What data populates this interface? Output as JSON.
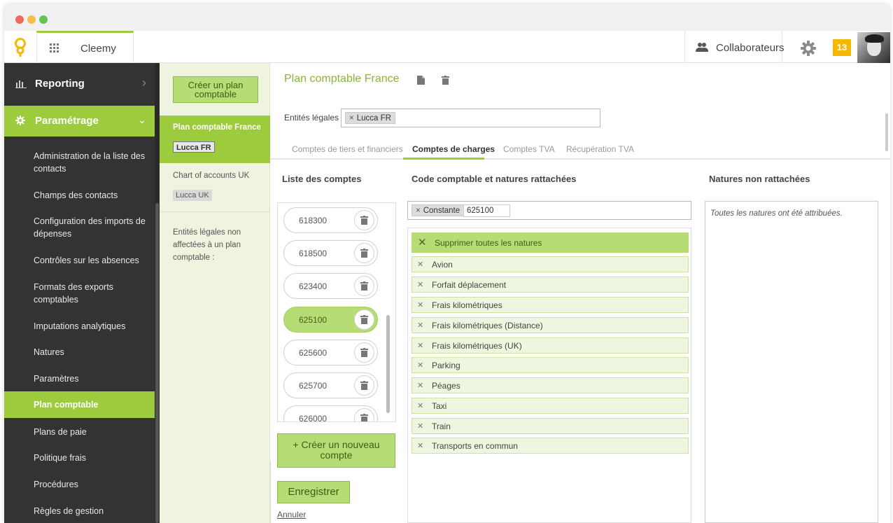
{
  "app": {
    "name": "Cleemy"
  },
  "header": {
    "collaborators_label": "Collaborateurs",
    "notifications_count": "13",
    "accent_color": "#9ccb3d",
    "badge_color": "#f5b800"
  },
  "sidebar": {
    "reporting": "Reporting",
    "parametrage": "Paramétrage",
    "items": [
      {
        "label": "Administration de la liste des contacts"
      },
      {
        "label": "Champs des contacts"
      },
      {
        "label": "Configuration des imports de dépenses"
      },
      {
        "label": "Contrôles sur les absences"
      },
      {
        "label": "Formats des exports comptables"
      },
      {
        "label": "Imputations analytiques"
      },
      {
        "label": "Natures"
      },
      {
        "label": "Paramètres"
      },
      {
        "label": "Plan comptable"
      },
      {
        "label": "Plans de paie"
      },
      {
        "label": "Politique frais"
      },
      {
        "label": "Procédures"
      },
      {
        "label": "Règles de gestion"
      }
    ],
    "active_item": "Plan comptable"
  },
  "plans": {
    "create_button": "Créer un plan comptable",
    "items": [
      {
        "title": "Plan comptable France",
        "tag": "Lucca FR"
      },
      {
        "title": "Chart of accounts UK",
        "tag": "Lucca UK"
      }
    ],
    "unassigned_text": "Entités légales non affectées à un plan comptable :"
  },
  "main": {
    "title": "Plan comptable France",
    "entities_label": "Entités légales :",
    "entities": [
      "Lucca FR"
    ],
    "tabs": [
      {
        "label": "Comptes de tiers et financiers"
      },
      {
        "label": "Comptes de charges"
      },
      {
        "label": "Comptes TVA"
      },
      {
        "label": "Récupération TVA"
      }
    ],
    "active_tab": "Comptes de charges",
    "accounts_header": "Liste des comptes",
    "accounts": [
      "618300",
      "618500",
      "623400",
      "625100",
      "625600",
      "625700",
      "626000"
    ],
    "selected_account": "625100",
    "new_account_button": "+ Créer un nouveau compte",
    "save_button": "Enregistrer",
    "cancel_link": "Annuler",
    "code_header": "Code comptable et natures rattachées",
    "code_chip": "Constante",
    "code_value": "625100",
    "delete_all_label": "Supprimer toutes les natures",
    "natures": [
      "Avion",
      "Forfait déplacement",
      "Frais kilométriques",
      "Frais kilométriques (Distance)",
      "Frais kilométriques (UK)",
      "Parking",
      "Péages",
      "Taxi",
      "Train",
      "Transports en commun"
    ],
    "unattached_header": "Natures non rattachées",
    "unattached_text": "Toutes les natures ont été attribuées."
  }
}
